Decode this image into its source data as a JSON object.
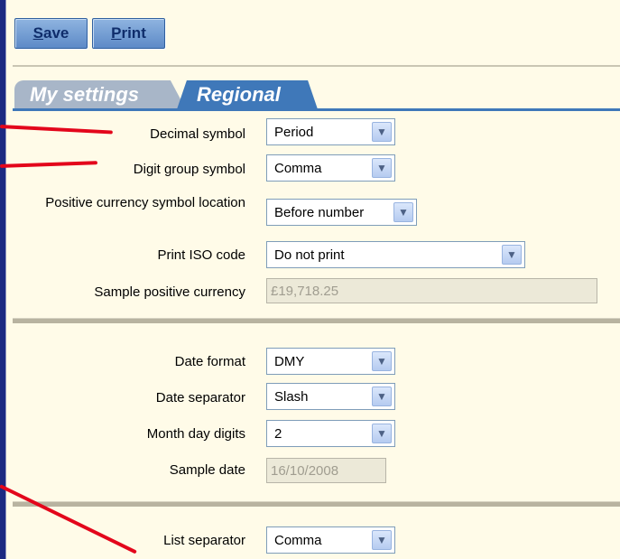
{
  "toolbar": {
    "save": {
      "mnemonic": "S",
      "rest": "ave"
    },
    "print": {
      "mnemonic": "P",
      "rest": "rint"
    }
  },
  "tabs": [
    {
      "label": "My settings",
      "active": false
    },
    {
      "label": "Regional",
      "active": true
    }
  ],
  "number_section": {
    "decimal_symbol": {
      "label": "Decimal symbol",
      "value": "Period"
    },
    "digit_group_symbol": {
      "label": "Digit group symbol",
      "value": "Comma"
    },
    "positive_currency_location": {
      "label": "Positive currency symbol location",
      "value": "Before number"
    },
    "print_iso_code": {
      "label": "Print ISO code",
      "value": "Do not print"
    },
    "sample_positive_currency": {
      "label": "Sample positive currency",
      "value": "£19,718.25"
    }
  },
  "date_section": {
    "date_format": {
      "label": "Date format",
      "value": "DMY"
    },
    "date_separator": {
      "label": "Date separator",
      "value": "Slash"
    },
    "month_day_digits": {
      "label": "Month day digits",
      "value": "2"
    },
    "sample_date": {
      "label": "Sample date",
      "value": "16/10/2008"
    }
  },
  "list_section": {
    "list_separator": {
      "label": "List separator",
      "value": "Comma"
    }
  },
  "colors": {
    "background": "#fffbe8",
    "active_tab": "#3f78b9",
    "inactive_tab": "#a8b6c8",
    "annotation": "#e3061b"
  },
  "icons": {
    "dropdown_arrow": "chevron-down-icon"
  }
}
